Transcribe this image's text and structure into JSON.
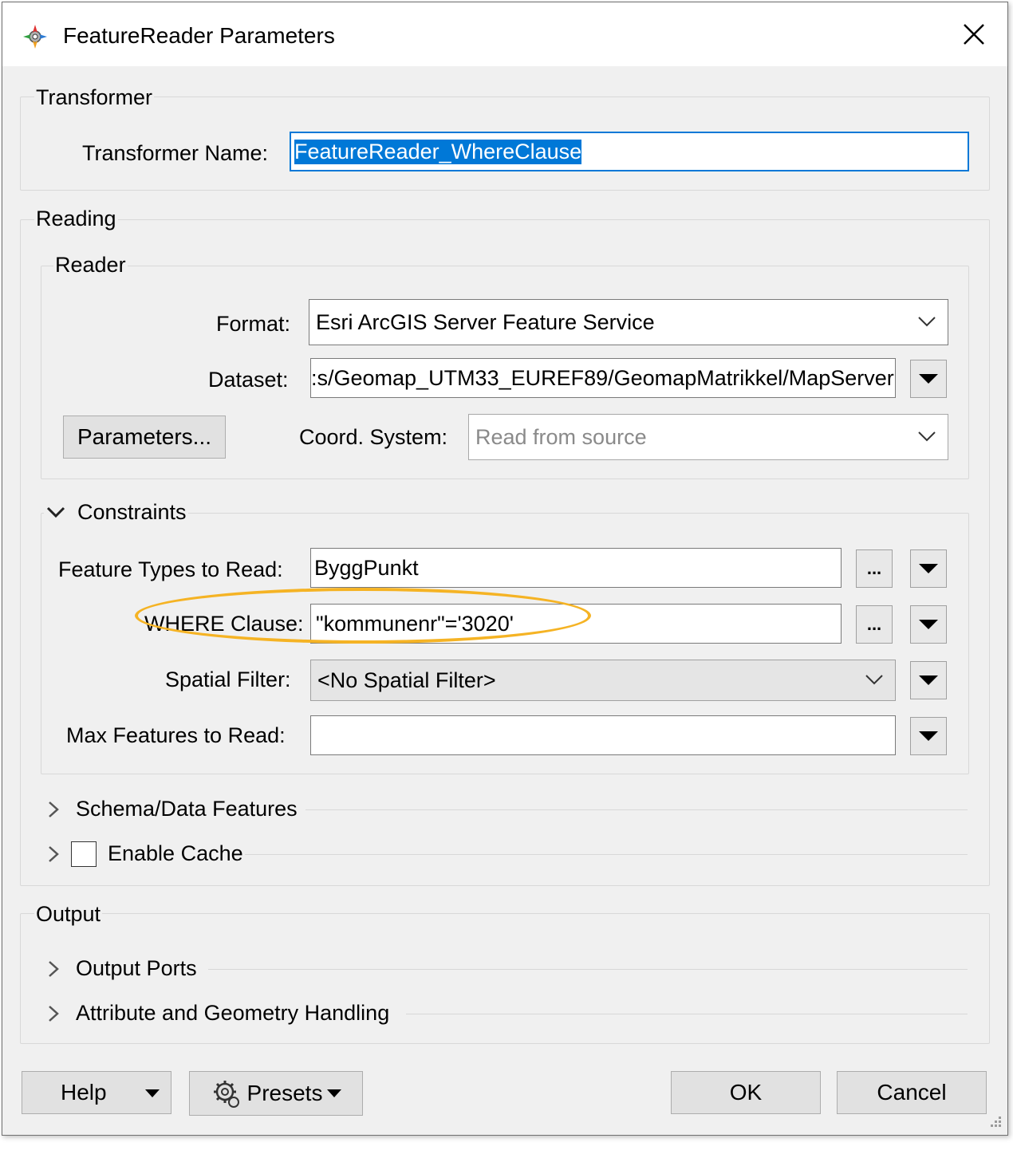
{
  "window": {
    "title": "FeatureReader Parameters"
  },
  "transformer": {
    "legend": "Transformer",
    "name_label": "Transformer Name:",
    "name_value": "FeatureReader_WhereClause"
  },
  "reading": {
    "legend": "Reading",
    "reader": {
      "legend": "Reader",
      "format_label": "Format:",
      "format_value": "Esri ArcGIS Server Feature Service",
      "dataset_label": "Dataset:",
      "dataset_value": ":s/Geomap_UTM33_EUREF89/GeomapMatrikkel/MapServer",
      "parameters_button": "Parameters...",
      "coord_label": "Coord. System:",
      "coord_placeholder": "Read from source"
    },
    "constraints": {
      "legend": "Constraints",
      "feature_types_label": "Feature Types to Read:",
      "feature_types_value": "ByggPunkt",
      "where_label": "WHERE Clause:",
      "where_value": "\"kommunenr\"='3020'",
      "spatial_label": "Spatial Filter:",
      "spatial_value": "<No Spatial Filter>",
      "max_label": "Max Features to Read:",
      "max_value": "",
      "ellipsis": "..."
    },
    "schema_section": "Schema/Data Features",
    "cache_section": "Enable Cache"
  },
  "output": {
    "legend": "Output",
    "ports_section": "Output Ports",
    "handling_section": "Attribute and Geometry Handling"
  },
  "footer": {
    "help": "Help",
    "presets": "Presets",
    "ok": "OK",
    "cancel": "Cancel"
  },
  "highlight_color": "#f5b324",
  "selection_color": "#0078d7"
}
